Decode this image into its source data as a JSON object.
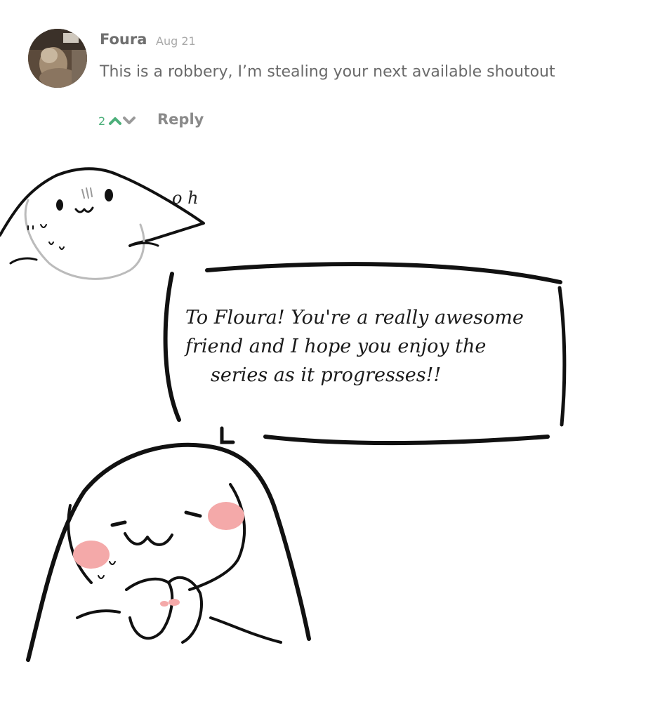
{
  "comment": {
    "author": "Foura",
    "date": "Aug 21",
    "text": "This is a robbery, I’m stealing your next available shoutout",
    "vote_count": "2",
    "reply_label": "Reply",
    "accent_color": "#4caf7a"
  },
  "comic": {
    "sound_effect": "o h",
    "speech_lines": [
      "To Floura! You're a really awesome",
      "friend and I hope you enjoy the",
      "series as it progresses!!"
    ]
  }
}
